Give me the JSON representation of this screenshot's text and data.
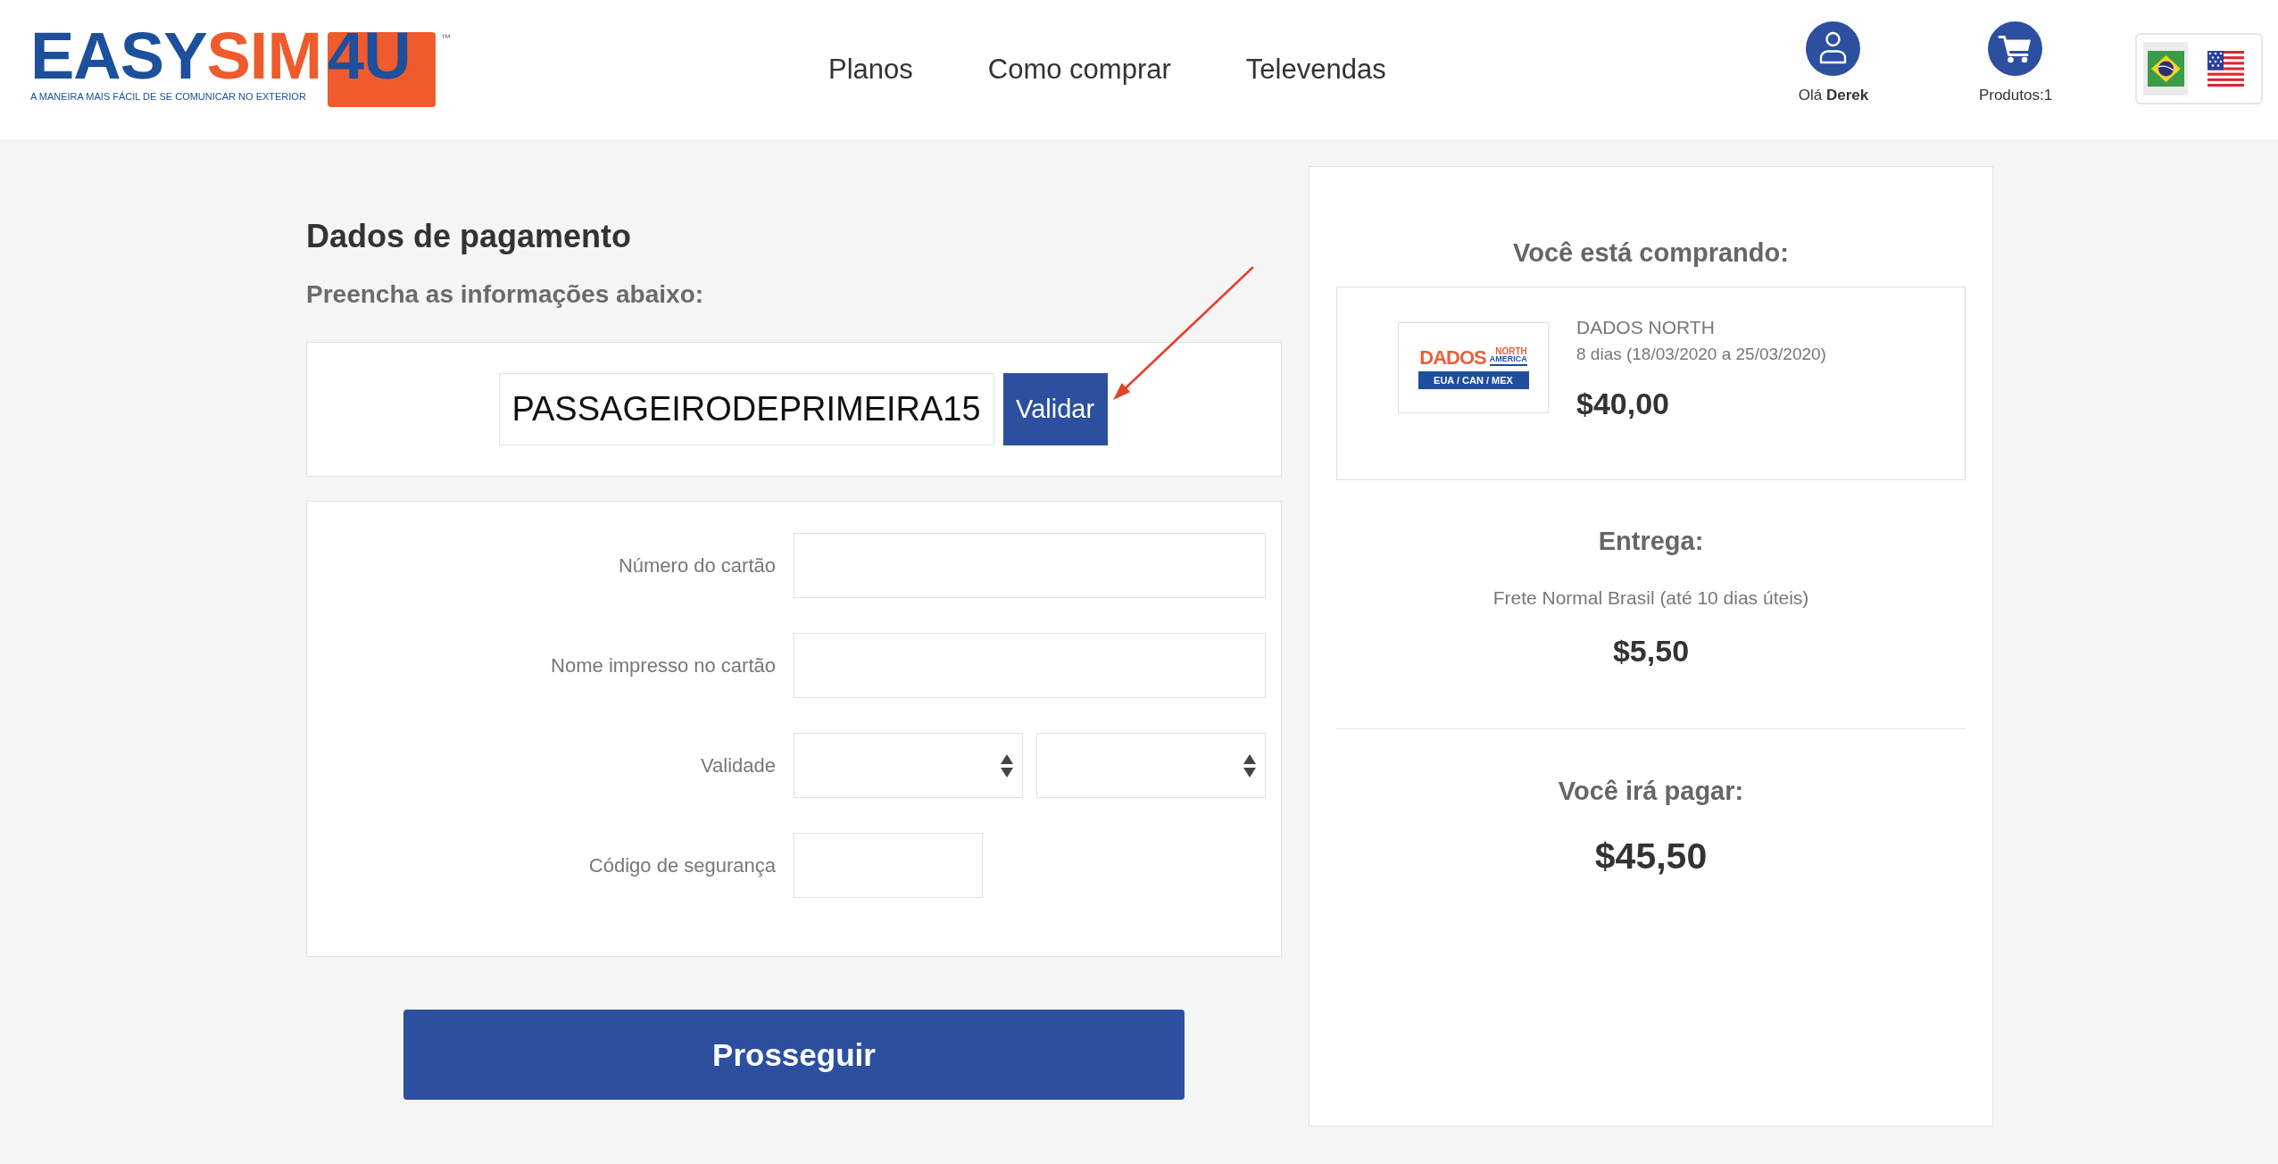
{
  "header": {
    "logo": {
      "word_1": "EASY",
      "word_2": "SIM",
      "badge": "4U",
      "trademark": "™",
      "tagline": "A MANEIRA MAIS FÁCIL DE SE COMUNICAR NO EXTERIOR"
    },
    "nav": [
      "Planos",
      "Como comprar",
      "Televendas"
    ],
    "account": {
      "greeting": "Olá **Derek**"
    },
    "cart": {
      "label": "Produtos:1"
    },
    "languages": [
      {
        "kind": "brazil",
        "selected": true
      },
      {
        "kind": "usa",
        "selected": false
      }
    ]
  },
  "payment": {
    "title": "Dados de pagamento",
    "subtitle": "Preencha as informações abaixo:",
    "coupon": {
      "value": "PASSAGEIRODEPRIMEIRA15",
      "button": "Validar"
    },
    "fields": [
      {
        "kind": "text",
        "label": "Número do cartão"
      },
      {
        "kind": "text",
        "label": "Nome impresso no cartão"
      },
      {
        "kind": "select",
        "label": "Validade"
      },
      {
        "kind": "short",
        "label": "Código de segurança"
      }
    ],
    "submit": "Prosseguir"
  },
  "summary": {
    "title": "Você está comprando:",
    "product": {
      "image": {
        "title": "DADOS",
        "line_1": "NORTH",
        "line_2": "AMERICA",
        "band": "EUA / CAN / MEX"
      },
      "name": "DADOS NORTH",
      "duration": "8 dias (18/03/2020 a 25/03/2020)",
      "price": "$40,00"
    },
    "delivery": {
      "title": "Entrega:",
      "method": "Frete Normal Brasil (até 10 dias úteis)",
      "price": "$5,50"
    },
    "total": {
      "title": "Você irá pagar:",
      "price": "$45,50"
    }
  }
}
